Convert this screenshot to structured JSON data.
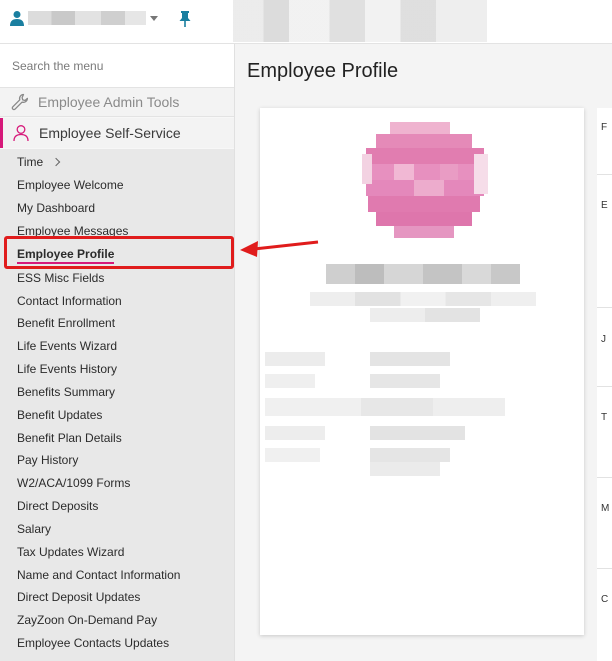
{
  "search": {
    "placeholder": "Search the menu"
  },
  "sidebar": {
    "admin_label": "Employee Admin Tools",
    "ess_label": "Employee Self-Service",
    "items": [
      {
        "label": "Time",
        "has_chevron": true
      },
      {
        "label": "Employee Welcome"
      },
      {
        "label": "My Dashboard"
      },
      {
        "label": "Employee Messages"
      },
      {
        "label": "Employee Profile",
        "active": true
      },
      {
        "label": "ESS Misc Fields"
      },
      {
        "label": "Contact Information"
      },
      {
        "label": "Benefit Enrollment"
      },
      {
        "label": "Life Events Wizard"
      },
      {
        "label": "Life Events History"
      },
      {
        "label": "Benefits Summary"
      },
      {
        "label": "Benefit Updates"
      },
      {
        "label": "Benefit Plan Details"
      },
      {
        "label": "Pay History"
      },
      {
        "label": "W2/ACA/1099 Forms"
      },
      {
        "label": "Direct Deposits"
      },
      {
        "label": "Salary"
      },
      {
        "label": "Tax Updates Wizard"
      },
      {
        "label": "Name and Contact Information"
      },
      {
        "label": "Direct Deposit Updates"
      },
      {
        "label": "ZayZoon On-Demand Pay"
      },
      {
        "label": "Employee Contacts Updates"
      }
    ]
  },
  "main": {
    "title": "Employee Profile"
  },
  "right_panel": {
    "letters": [
      "F",
      "E",
      "J",
      "T",
      "M",
      "C"
    ]
  },
  "colors": {
    "accent": "#d6197a",
    "highlight": "#e01c1c",
    "icon_teal": "#1a7fa0"
  },
  "icons": {
    "user": "user-icon",
    "pin": "pin-icon",
    "wrench": "wrench-icon",
    "person": "person-outline-icon",
    "chevron": "chevron-right-icon"
  }
}
